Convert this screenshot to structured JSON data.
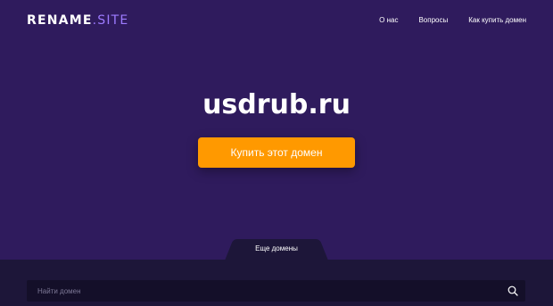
{
  "header": {
    "logo_main": "RENAME",
    "logo_accent": ".SITE",
    "nav": [
      {
        "label": "О нас"
      },
      {
        "label": "Вопросы"
      },
      {
        "label": "Как купить домен"
      }
    ]
  },
  "hero": {
    "domain": "usdrub.ru",
    "buy_button_label": "Купить этот домен"
  },
  "more_domains": {
    "tab_label": "Еще домены",
    "search_placeholder": "Найти домен",
    "search_icon": "search-icon"
  },
  "colors": {
    "background": "#2f1b5d",
    "accent": "#9d7bff",
    "button": "#ff9900",
    "panel": "#1d1639"
  }
}
